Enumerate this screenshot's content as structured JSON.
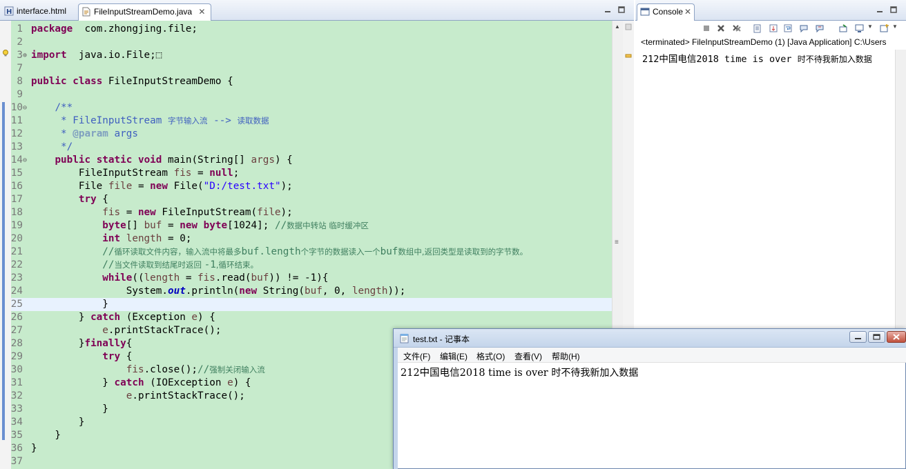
{
  "editor": {
    "tabs": [
      {
        "label": "interface.html",
        "icon": "html-file-icon",
        "active": false
      },
      {
        "label": "FileInputStreamDemo.java",
        "icon": "java-file-icon",
        "active": true
      }
    ],
    "close_glyph": "✕",
    "fold_expanded": "⊖",
    "fold_collapsed": "⊕",
    "overview_ruler_glyph": "≡",
    "lines": [
      {
        "n": "1",
        "tokens": [
          [
            "kw",
            "package"
          ],
          [
            "",
            "  com.zhongjing.file;"
          ]
        ]
      },
      {
        "n": "2",
        "tokens": []
      },
      {
        "n": "3",
        "fold": "collapsed",
        "tokens": [
          [
            "kw",
            "import"
          ],
          [
            "",
            "  java.io.File;"
          ],
          [
            "",
            "⬚"
          ]
        ]
      },
      {
        "n": "7",
        "tokens": []
      },
      {
        "n": "8",
        "tokens": [
          [
            "kw",
            "public"
          ],
          [
            "",
            " "
          ],
          [
            "kw",
            "class"
          ],
          [
            "",
            " FileInputStreamDemo {"
          ]
        ]
      },
      {
        "n": "9",
        "tokens": []
      },
      {
        "n": "10",
        "fold": "expanded",
        "tokens": [
          [
            "",
            "    "
          ],
          [
            "jd",
            "/**"
          ]
        ]
      },
      {
        "n": "11",
        "tokens": [
          [
            "jd",
            "     * FileInputStream "
          ],
          [
            "jd cjk",
            "字节输入流"
          ],
          [
            "jd",
            " --> "
          ],
          [
            "jd cjk",
            "读取数据"
          ]
        ]
      },
      {
        "n": "12",
        "tokens": [
          [
            "jd",
            "     * "
          ],
          [
            "tag",
            "@param"
          ],
          [
            "jd",
            " args"
          ]
        ]
      },
      {
        "n": "13",
        "tokens": [
          [
            "jd",
            "     */"
          ]
        ]
      },
      {
        "n": "14",
        "fold": "expanded",
        "tokens": [
          [
            "",
            "    "
          ],
          [
            "kw",
            "public"
          ],
          [
            "",
            " "
          ],
          [
            "kw",
            "static"
          ],
          [
            "",
            " "
          ],
          [
            "kw",
            "void"
          ],
          [
            "",
            " main(String[] "
          ],
          [
            "var",
            "args"
          ],
          [
            "",
            ") {"
          ]
        ]
      },
      {
        "n": "15",
        "tokens": [
          [
            "",
            "        FileInputStream "
          ],
          [
            "var",
            "fis"
          ],
          [
            "",
            " = "
          ],
          [
            "kw",
            "null"
          ],
          [
            "",
            ";"
          ]
        ]
      },
      {
        "n": "16",
        "tokens": [
          [
            "",
            "        File "
          ],
          [
            "var",
            "file"
          ],
          [
            "",
            " = "
          ],
          [
            "kw",
            "new"
          ],
          [
            "",
            " File("
          ],
          [
            "str",
            "\"D:/test.txt\""
          ],
          [
            "",
            ");"
          ]
        ]
      },
      {
        "n": "17",
        "tokens": [
          [
            "",
            "        "
          ],
          [
            "kw",
            "try"
          ],
          [
            "",
            " {"
          ]
        ]
      },
      {
        "n": "18",
        "tokens": [
          [
            "",
            "            "
          ],
          [
            "var",
            "fis"
          ],
          [
            "",
            " = "
          ],
          [
            "kw",
            "new"
          ],
          [
            "",
            " FileInputStream("
          ],
          [
            "var",
            "file"
          ],
          [
            "",
            ");"
          ]
        ]
      },
      {
        "n": "19",
        "tokens": [
          [
            "",
            "            "
          ],
          [
            "kw",
            "byte"
          ],
          [
            "",
            "[] "
          ],
          [
            "var",
            "buf"
          ],
          [
            "",
            " = "
          ],
          [
            "kw",
            "new"
          ],
          [
            "",
            " "
          ],
          [
            "kw",
            "byte"
          ],
          [
            "",
            "[1024]; "
          ],
          [
            "cm",
            "//"
          ],
          [
            "cm cjk",
            "数据中转站 临时缓冲区"
          ]
        ]
      },
      {
        "n": "20",
        "tokens": [
          [
            "",
            "            "
          ],
          [
            "kw",
            "int"
          ],
          [
            "",
            " "
          ],
          [
            "var",
            "length"
          ],
          [
            "",
            " = 0;"
          ]
        ]
      },
      {
        "n": "21",
        "tokens": [
          [
            "",
            "            "
          ],
          [
            "cm",
            "//"
          ],
          [
            "cm cjk",
            "循环读取文件内容，输入流中将最多"
          ],
          [
            "cm",
            "buf.length"
          ],
          [
            "cm cjk",
            "个字节的数据读入一个"
          ],
          [
            "cm",
            "buf"
          ],
          [
            "cm cjk",
            "数组中,返回类型是读取到的字节数。"
          ]
        ]
      },
      {
        "n": "22",
        "tokens": [
          [
            "",
            "            "
          ],
          [
            "cm",
            "//"
          ],
          [
            "cm cjk",
            "当文件读取到结尾时返回 "
          ],
          [
            "cm",
            "-1"
          ],
          [
            "cm cjk",
            ",循环结束。"
          ]
        ]
      },
      {
        "n": "23",
        "tokens": [
          [
            "",
            "            "
          ],
          [
            "kw",
            "while"
          ],
          [
            "",
            "(("
          ],
          [
            "var",
            "length"
          ],
          [
            "",
            " = "
          ],
          [
            "var",
            "fis"
          ],
          [
            "",
            ".read("
          ],
          [
            "var",
            "buf"
          ],
          [
            "",
            ")) != -1){"
          ]
        ]
      },
      {
        "n": "24",
        "tokens": [
          [
            "",
            "                System."
          ],
          [
            "sfld",
            "out"
          ],
          [
            "",
            ".println("
          ],
          [
            "kw",
            "new"
          ],
          [
            "",
            " String("
          ],
          [
            "var",
            "buf"
          ],
          [
            "",
            ", 0, "
          ],
          [
            "var",
            "length"
          ],
          [
            "",
            "));"
          ]
        ]
      },
      {
        "n": "25",
        "current": true,
        "tokens": [
          [
            "",
            "            }"
          ]
        ]
      },
      {
        "n": "26",
        "tokens": [
          [
            "",
            "        } "
          ],
          [
            "kw",
            "catch"
          ],
          [
            "",
            " (Exception "
          ],
          [
            "var",
            "e"
          ],
          [
            "",
            ") {"
          ]
        ]
      },
      {
        "n": "27",
        "tokens": [
          [
            "",
            "            "
          ],
          [
            "var",
            "e"
          ],
          [
            "",
            ".printStackTrace();"
          ]
        ]
      },
      {
        "n": "28",
        "tokens": [
          [
            "",
            "        }"
          ],
          [
            "kw",
            "finally"
          ],
          [
            "",
            "{"
          ]
        ]
      },
      {
        "n": "29",
        "tokens": [
          [
            "",
            "            "
          ],
          [
            "kw",
            "try"
          ],
          [
            "",
            " {"
          ]
        ]
      },
      {
        "n": "30",
        "tokens": [
          [
            "",
            "                "
          ],
          [
            "var",
            "fis"
          ],
          [
            "",
            ".close();"
          ],
          [
            "cm",
            "//"
          ],
          [
            "cm cjk",
            "强制关闭输入流"
          ]
        ]
      },
      {
        "n": "31",
        "tokens": [
          [
            "",
            "            } "
          ],
          [
            "kw",
            "catch"
          ],
          [
            "",
            " (IOException "
          ],
          [
            "var",
            "e"
          ],
          [
            "",
            ") {"
          ]
        ]
      },
      {
        "n": "32",
        "tokens": [
          [
            "",
            "                "
          ],
          [
            "var",
            "e"
          ],
          [
            "",
            ".printStackTrace();"
          ]
        ]
      },
      {
        "n": "33",
        "tokens": [
          [
            "",
            "            }"
          ]
        ]
      },
      {
        "n": "34",
        "tokens": [
          [
            "",
            "        }"
          ]
        ]
      },
      {
        "n": "35",
        "tokens": [
          [
            "",
            "    }"
          ]
        ]
      },
      {
        "n": "36",
        "tokens": [
          [
            "",
            "}"
          ]
        ]
      },
      {
        "n": "37",
        "tokens": []
      }
    ]
  },
  "console": {
    "tab_label": "Console",
    "status": "<terminated> FileInputStreamDemo (1) [Java Application] C:\\Users",
    "output_prefix": "212中国电信2018 time is over ",
    "output_suffix": "时不待我新加入数据",
    "toolbar_icons": [
      "terminate-icon",
      "remove-launch-icon",
      "remove-all-terminated-icon",
      "clear-console-icon",
      "scroll-lock-icon",
      "word-wrap-icon",
      "show-on-stdout-icon",
      "show-on-stderr-icon",
      "pin-console-icon",
      "display-selected-console-icon",
      "open-console-icon"
    ]
  },
  "notepad": {
    "title": "test.txt - 记事本",
    "menu": [
      "文件(F)",
      "编辑(E)",
      "格式(O)",
      "查看(V)",
      "帮助(H)"
    ],
    "content_prefix": "212中国电信2018 time is over ",
    "content_suffix": "时不待我新加入数据"
  }
}
